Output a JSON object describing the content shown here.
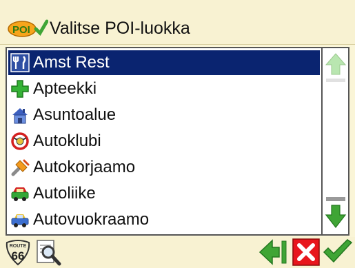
{
  "header": {
    "title": "Valitse POI-luokka",
    "logo_text": "POI"
  },
  "list": {
    "selected_index": 0,
    "items": [
      {
        "label": "Amst Rest",
        "icon": "restaurant-icon"
      },
      {
        "label": "Apteekki",
        "icon": "pharmacy-cross-icon"
      },
      {
        "label": "Asuntoalue",
        "icon": "residential-area-icon"
      },
      {
        "label": "Autoklubi",
        "icon": "auto-club-icon"
      },
      {
        "label": "Autokorjaamo",
        "icon": "car-repair-icon"
      },
      {
        "label": "Autoliike",
        "icon": "car-dealer-icon"
      },
      {
        "label": "Autovuokraamo",
        "icon": "car-rental-icon"
      }
    ]
  },
  "toolbar": {
    "route_badge_text": "66",
    "route_badge_top": "ROUTE"
  },
  "colors": {
    "background": "#FAF5D7",
    "selection": "#0A2470",
    "accent_green": "#3FA535",
    "cancel_red": "#E8161C"
  }
}
